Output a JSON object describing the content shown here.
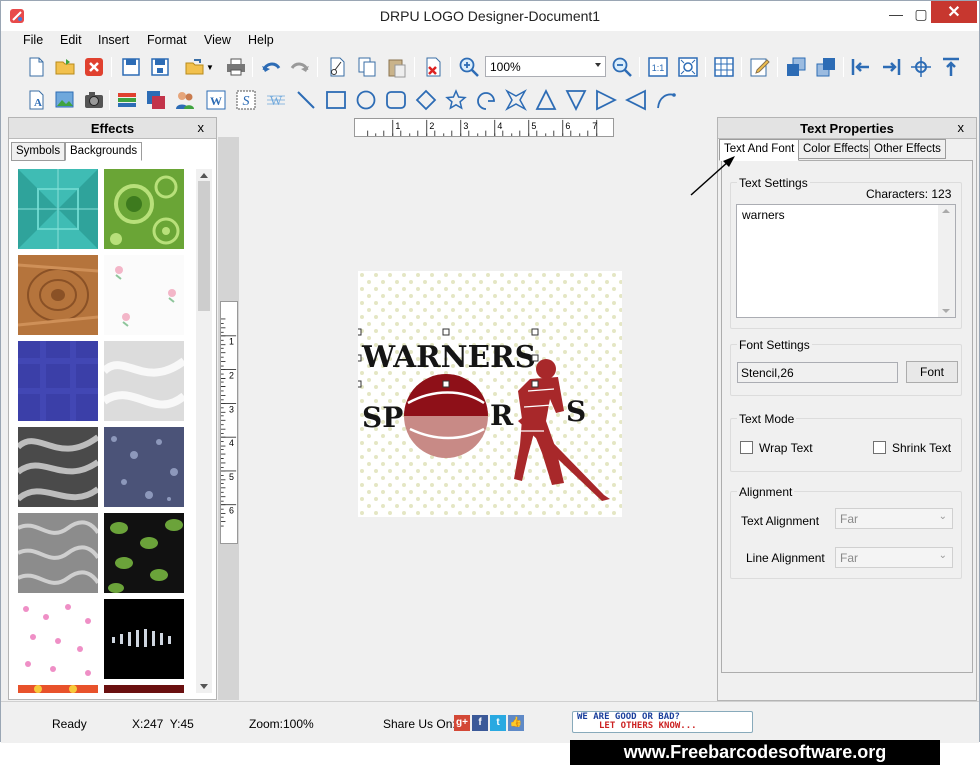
{
  "window": {
    "title": "DRPU LOGO Designer-Document1"
  },
  "menu": [
    "File",
    "Edit",
    "Insert",
    "Format",
    "View",
    "Help"
  ],
  "toolbar": {
    "zoom_value": "100%"
  },
  "effects_panel": {
    "title": "Effects",
    "close": "x",
    "tabs": [
      "Symbols",
      "Backgrounds"
    ],
    "active_tab": "Backgrounds"
  },
  "ruler": {
    "top_ticks": [
      "1",
      "2",
      "3",
      "4",
      "5",
      "6",
      "7"
    ],
    "left_ticks": [
      "1",
      "2",
      "3",
      "4",
      "5",
      "6"
    ]
  },
  "design": {
    "line1": "WARNERS",
    "line2_left": "SP",
    "line2_mid": "R",
    "line2_right": "S"
  },
  "text_properties": {
    "title": "Text Properties",
    "close": "x",
    "tabs": [
      "Text And Font",
      "Color Effects",
      "Other Effects"
    ],
    "text_settings": {
      "label": "Text Settings",
      "characters": "Characters: 123",
      "value": "warners"
    },
    "font_settings": {
      "label": "Font Settings",
      "value": "Stencil,26",
      "button": "Font"
    },
    "text_mode": {
      "label": "Text Mode",
      "wrap": "Wrap Text",
      "shrink": "Shrink Text"
    },
    "alignment": {
      "label": "Alignment",
      "text_alignment_label": "Text Alignment",
      "text_alignment_value": "Far",
      "line_alignment_label": "Line Alignment",
      "line_alignment_value": "Far"
    }
  },
  "status": {
    "state": "Ready",
    "coords": "X:247  Y:45",
    "zoom": "Zoom:100%",
    "share": "Share Us On:"
  },
  "feedback": {
    "line1": "WE ARE GOOD OR BAD?",
    "line2": "LET OTHERS KNOW..."
  },
  "watermark": "www.Freebarcodesoftware.org"
}
